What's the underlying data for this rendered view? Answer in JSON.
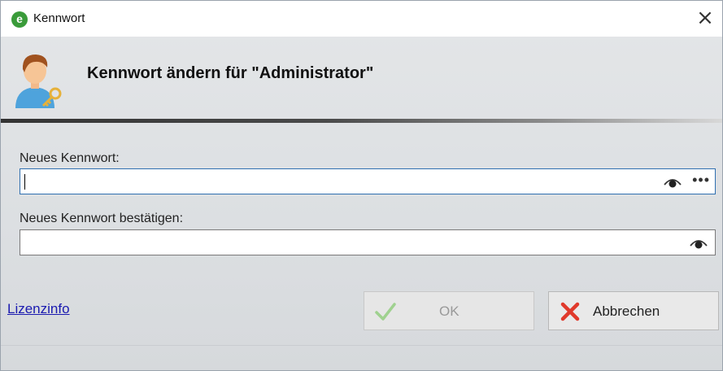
{
  "window": {
    "title": "Kennwort",
    "app_icon_letter": "e",
    "close_glyph": "×"
  },
  "header": {
    "title": "Kennwort ändern für \"Administrator\"",
    "icon": "user-key-icon"
  },
  "fields": {
    "new_password": {
      "label": "Neues Kennwort:",
      "value": ""
    },
    "confirm_password": {
      "label": "Neues Kennwort bestätigen:",
      "value": ""
    },
    "more_glyph": "•••"
  },
  "footer": {
    "license_link": "Lizenzinfo",
    "ok_label": "OK",
    "cancel_label": "Abbrechen"
  },
  "colors": {
    "accent_focus": "#2f6fb0",
    "ok_check": "#9fd18f",
    "cancel_x": "#e0392b",
    "link": "#1a1ab0"
  }
}
